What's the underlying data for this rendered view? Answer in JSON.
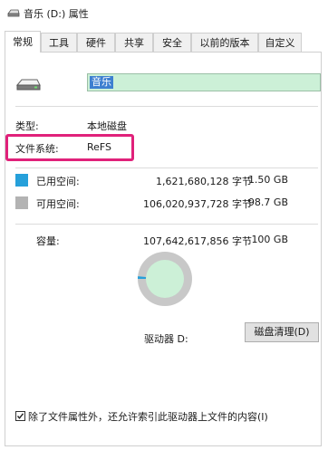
{
  "window": {
    "title": "音乐 (D:) 属性"
  },
  "tabs": [
    {
      "label": "常规"
    },
    {
      "label": "工具"
    },
    {
      "label": "硬件"
    },
    {
      "label": "共享"
    },
    {
      "label": "安全"
    },
    {
      "label": "以前的版本"
    },
    {
      "label": "自定义"
    }
  ],
  "general": {
    "volume_name": "音乐",
    "type_label": "类型:",
    "type_value": "本地磁盘",
    "fs_label": "文件系统:",
    "fs_value": "ReFS",
    "used": {
      "label": "已用空间:",
      "bytes": "1,621,680,128 字节",
      "size": "1.50 GB",
      "color": "#26a0da"
    },
    "free": {
      "label": "可用空间:",
      "bytes": "106,020,937,728 字节",
      "size": "98.7 GB",
      "color": "#b3b3b3"
    },
    "capacity": {
      "label": "容量:",
      "bytes": "107,642,617,856 字节",
      "size": "100 GB"
    },
    "drive_label": "驱动器 D:",
    "cleanup_button": "磁盘清理(D)",
    "index_checkbox": "除了文件属性外，还允许索引此驱动器上文件的内容(I)",
    "index_checked": true,
    "used_fraction": 0.015
  },
  "colors": {
    "free_ring": "#c8c8c8",
    "free_fill": "#ccf0d7",
    "used_slice": "#26a0da",
    "highlight": "#e0217a"
  }
}
